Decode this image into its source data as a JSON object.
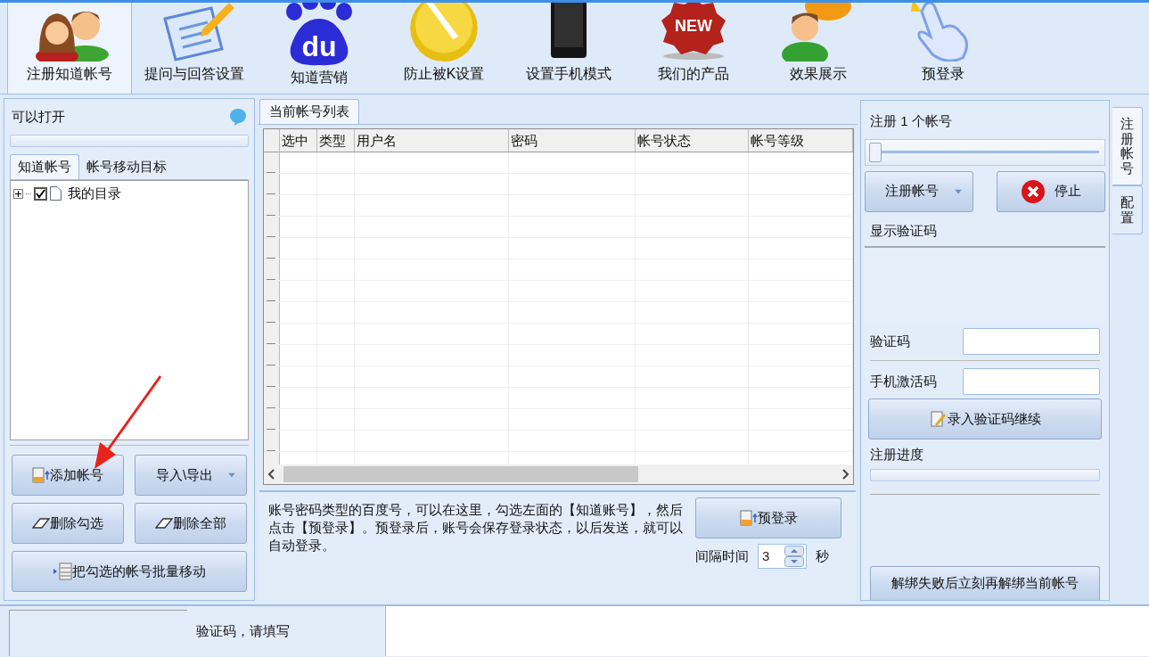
{
  "toolbar": [
    {
      "label": "注册知道帐号",
      "kind": "people",
      "selected": true
    },
    {
      "label": "提问与回答设置",
      "kind": "note",
      "selected": false
    },
    {
      "label": "知道营销",
      "kind": "paw",
      "icon_text": "du",
      "selected": false
    },
    {
      "label": "防止被K设置",
      "kind": "wrench",
      "selected": false
    },
    {
      "label": "设置手机模式",
      "kind": "phone",
      "selected": false
    },
    {
      "label": "我们的产品",
      "kind": "badge",
      "icon_text": "NEW",
      "selected": false
    },
    {
      "label": "效果展示",
      "kind": "speaker",
      "selected": false
    },
    {
      "label": "预登录",
      "kind": "hand",
      "selected": false
    }
  ],
  "left_panel": {
    "title": "可以打开",
    "progress": {
      "level": 0
    },
    "tabs": [
      {
        "label": "知道帐号",
        "selected": true
      },
      {
        "label": "帐号移动目标",
        "selected": false
      }
    ],
    "tree": [
      {
        "label": "我的目录",
        "checked": true,
        "expanded": false
      }
    ],
    "buttons": [
      {
        "label": "添加帐号",
        "kind": "add",
        "dropdown": false
      },
      {
        "label": "导入\\导出",
        "kind": "plain",
        "dropdown": true
      },
      {
        "label": "删除勾选",
        "kind": "eraser",
        "dropdown": false
      },
      {
        "label": "删除全部",
        "kind": "eraser",
        "dropdown": false
      },
      {
        "label": "把勾选的帐号批量移动",
        "kind": "move",
        "dropdown": false
      }
    ]
  },
  "center_panel": {
    "tabs": [
      {
        "label": "当前帐号列表",
        "selected": true
      }
    ],
    "table": {
      "columns": [
        "选中",
        "类型",
        "用户名",
        "密码",
        "帐号状态",
        "帐号等级"
      ]
    },
    "hint": "账号密码类型的百度号，可以在这里，勾选左面的【知道账号】，然后点击【预登录】。预登录后，账号会保存登录状态，以后发送，就可以自动登录。",
    "prelogin_button": "预登录",
    "interval_label": "间隔时间",
    "interval_value": "3",
    "interval_unit": "秒"
  },
  "right_panel": {
    "count_label": "注册 1 个帐号",
    "slider": {
      "level": 0
    },
    "register_button": "注册帐号",
    "stop_button": "停止",
    "captcha_title": "显示验证码",
    "captcha_label": "验证码",
    "sms_label": "手机激活码",
    "submit_button": "录入验证码继续",
    "progress_label": "注册进度",
    "progress": {
      "level": 0
    },
    "unbind_button": "解绑失败后立刻再解绑当前帐号"
  },
  "side_tabs": [
    {
      "label": "注册帐号",
      "selected": true
    },
    {
      "label": "配置",
      "selected": false
    }
  ],
  "status_bar": {
    "message": "验证码，请填写"
  }
}
